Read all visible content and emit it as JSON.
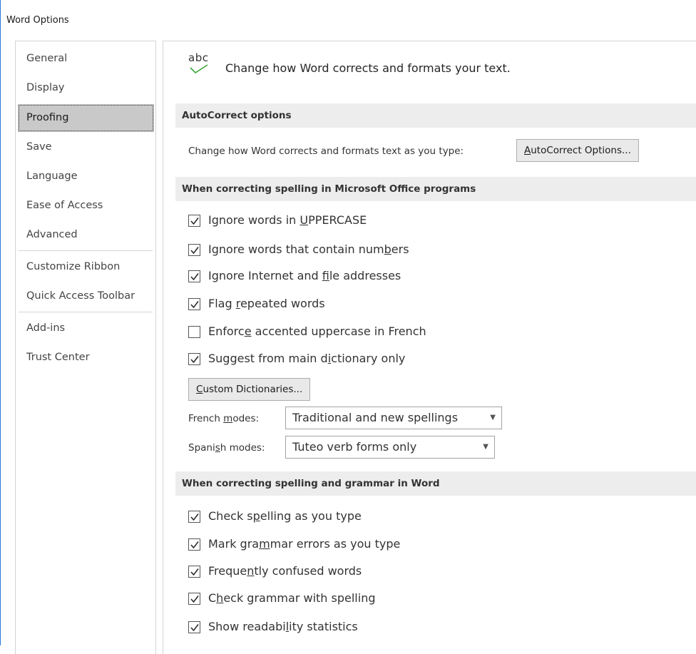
{
  "window": {
    "title": "Word Options"
  },
  "sidebar": {
    "items": [
      {
        "label": "General",
        "selected": false
      },
      {
        "label": "Display",
        "selected": false
      },
      {
        "label": "Proofing",
        "selected": true
      },
      {
        "label": "Save",
        "selected": false
      },
      {
        "label": "Language",
        "selected": false
      },
      {
        "label": "Ease of Access",
        "selected": false
      },
      {
        "label": "Advanced",
        "selected": false
      },
      {
        "label": "Customize Ribbon",
        "selected": false
      },
      {
        "label": "Quick Access Toolbar",
        "selected": false
      },
      {
        "label": "Add-ins",
        "selected": false
      },
      {
        "label": "Trust Center",
        "selected": false
      }
    ]
  },
  "header": {
    "icon_text": "abc",
    "icon_name": "spelling-check-icon",
    "text": "Change how Word corrects and formats your text."
  },
  "sections": {
    "autocorrect": {
      "title": "AutoCorrect options",
      "label": "Change how Word corrects and formats text as you type:",
      "button": {
        "pre": "",
        "key": "A",
        "post": "utoCorrect Options..."
      }
    },
    "office": {
      "title": "When correcting spelling in Microsoft Office programs",
      "options": [
        {
          "pre": "Ignore words in ",
          "key": "U",
          "post": "PPERCASE",
          "checked": true
        },
        {
          "pre": "Ignore words that contain num",
          "key": "b",
          "post": "ers",
          "checked": true
        },
        {
          "pre": "Ignore Internet and ",
          "key": "f",
          "post": "ile addresses",
          "checked": true
        },
        {
          "pre": "Flag ",
          "key": "r",
          "post": "epeated words",
          "checked": true
        },
        {
          "pre": "Enforc",
          "key": "e",
          "post": " accented uppercase in French",
          "checked": false
        },
        {
          "pre": "Suggest from main d",
          "key": "i",
          "post": "ctionary only",
          "checked": true
        }
      ],
      "custom_dictionaries": {
        "pre": "",
        "key": "C",
        "post": "ustom Dictionaries..."
      },
      "french": {
        "pre": "French ",
        "key": "m",
        "post": "odes:",
        "value": "Traditional and new spellings"
      },
      "spanish": {
        "pre": "Spani",
        "key": "s",
        "post": "h modes:",
        "value": "Tuteo verb forms only"
      }
    },
    "word": {
      "title": "When correcting spelling and grammar in Word",
      "options": [
        {
          "pre": "Check s",
          "key": "p",
          "post": "elling as you type",
          "checked": true
        },
        {
          "pre": "Mark gra",
          "key": "m",
          "post": "mar errors as you type",
          "checked": true
        },
        {
          "pre": "Freque",
          "key": "n",
          "post": "tly confused words",
          "checked": true
        },
        {
          "pre": "C",
          "key": "h",
          "post": "eck grammar with spelling",
          "checked": true
        },
        {
          "pre": "Show readabi",
          "key": "l",
          "post": "ity statistics",
          "checked": true
        }
      ]
    }
  },
  "colors": {
    "accent": "#2b79d8",
    "selected_bg": "#c9c9c9",
    "section_bg": "#ededed",
    "check": "#3aa63a"
  }
}
